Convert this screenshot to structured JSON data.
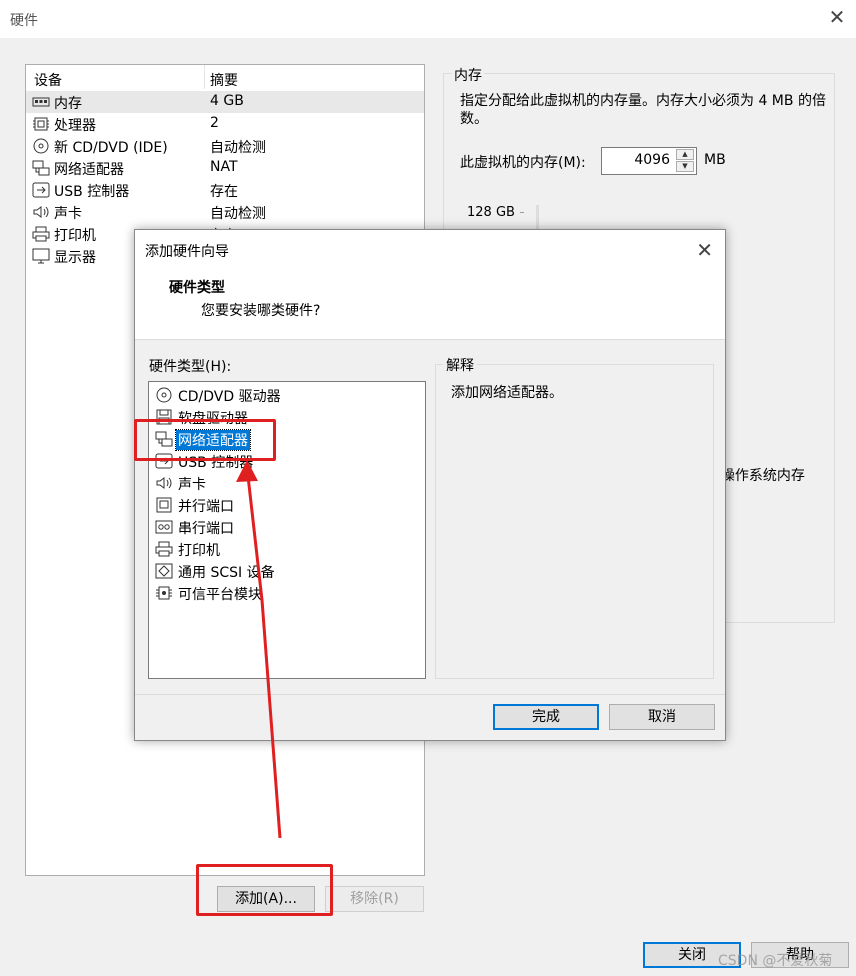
{
  "window": {
    "title": "硬件"
  },
  "device_list": {
    "header": {
      "device": "设备",
      "summary": "摘要"
    },
    "items": [
      {
        "name": "内存",
        "summary": "4 GB",
        "icon": "memory-icon",
        "selected": true
      },
      {
        "name": "处理器",
        "summary": "2",
        "icon": "processor-icon"
      },
      {
        "name": "新 CD/DVD (IDE)",
        "summary": "自动检测",
        "icon": "cd-dvd-icon"
      },
      {
        "name": "网络适配器",
        "summary": "NAT",
        "icon": "network-adapter-icon"
      },
      {
        "name": "USB 控制器",
        "summary": "存在",
        "icon": "usb-icon"
      },
      {
        "name": "声卡",
        "summary": "自动检测",
        "icon": "sound-card-icon"
      },
      {
        "name": "打印机",
        "summary": "存在",
        "icon": "printer-icon"
      },
      {
        "name": "显示器",
        "summary": "",
        "icon": "display-icon"
      }
    ],
    "add_button": "添加(A)...",
    "remove_button": "移除(R)"
  },
  "memory": {
    "group_title": "内存",
    "description": "指定分配给此虚拟机的内存量。内存大小必须为 4 MB 的倍数。",
    "field_label": "此虚拟机的内存(M):",
    "value": "4096",
    "unit": "MB",
    "scale_max": "128 GB",
    "partial_text": "l操作系统内存"
  },
  "wizard": {
    "title": "添加硬件向导",
    "heading": "硬件类型",
    "subheading": "您要安装哪类硬件?",
    "list_label": "硬件类型(H):",
    "items": [
      {
        "label": "CD/DVD 驱动器",
        "icon": "cd-dvd-icon"
      },
      {
        "label": "软盘驱动器",
        "icon": "floppy-icon"
      },
      {
        "label": "网络适配器",
        "icon": "network-adapter-icon",
        "selected": true
      },
      {
        "label": "USB 控制器",
        "icon": "usb-icon"
      },
      {
        "label": "声卡",
        "icon": "sound-card-icon"
      },
      {
        "label": "并行端口",
        "icon": "parallel-port-icon"
      },
      {
        "label": "串行端口",
        "icon": "serial-port-icon"
      },
      {
        "label": "打印机",
        "icon": "printer-icon"
      },
      {
        "label": "通用 SCSI 设备",
        "icon": "scsi-icon"
      },
      {
        "label": "可信平台模块",
        "icon": "tpm-icon"
      }
    ],
    "explanation_title": "解释",
    "explanation_text": "添加网络适配器。",
    "finish_button": "完成",
    "cancel_button": "取消"
  },
  "footer": {
    "close_button": "关闭",
    "help_button": "帮助"
  },
  "watermark": "CSDN @不爱秋菊",
  "colors": {
    "selection": "#0078d7",
    "annotation": "#e02020"
  }
}
